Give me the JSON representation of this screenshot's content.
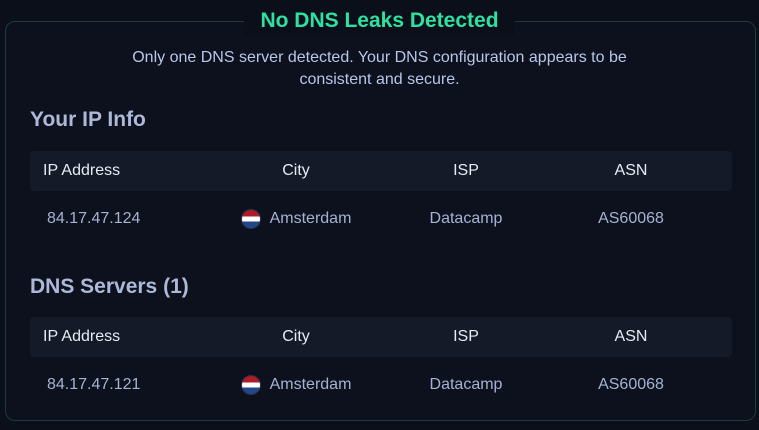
{
  "status": {
    "title": "No DNS Leaks Detected",
    "description_line1": "Only one DNS server detected. Your DNS configuration appears to be",
    "description_line2": "consistent and secure.",
    "accent_color": "#2fe0a0"
  },
  "ip_info": {
    "heading": "Your IP Info",
    "columns": [
      "IP Address",
      "City",
      "ISP",
      "ASN"
    ],
    "rows": [
      {
        "ip": "84.17.47.124",
        "city": "Amsterdam",
        "flag_icon": "netherlands-flag-icon",
        "isp": "Datacamp",
        "asn": "AS60068"
      }
    ]
  },
  "dns_servers": {
    "heading": "DNS Servers (1)",
    "columns": [
      "IP Address",
      "City",
      "ISP",
      "ASN"
    ],
    "rows": [
      {
        "ip": "84.17.47.121",
        "city": "Amsterdam",
        "flag_icon": "netherlands-flag-icon",
        "isp": "Datacamp",
        "asn": "AS60068"
      }
    ]
  }
}
